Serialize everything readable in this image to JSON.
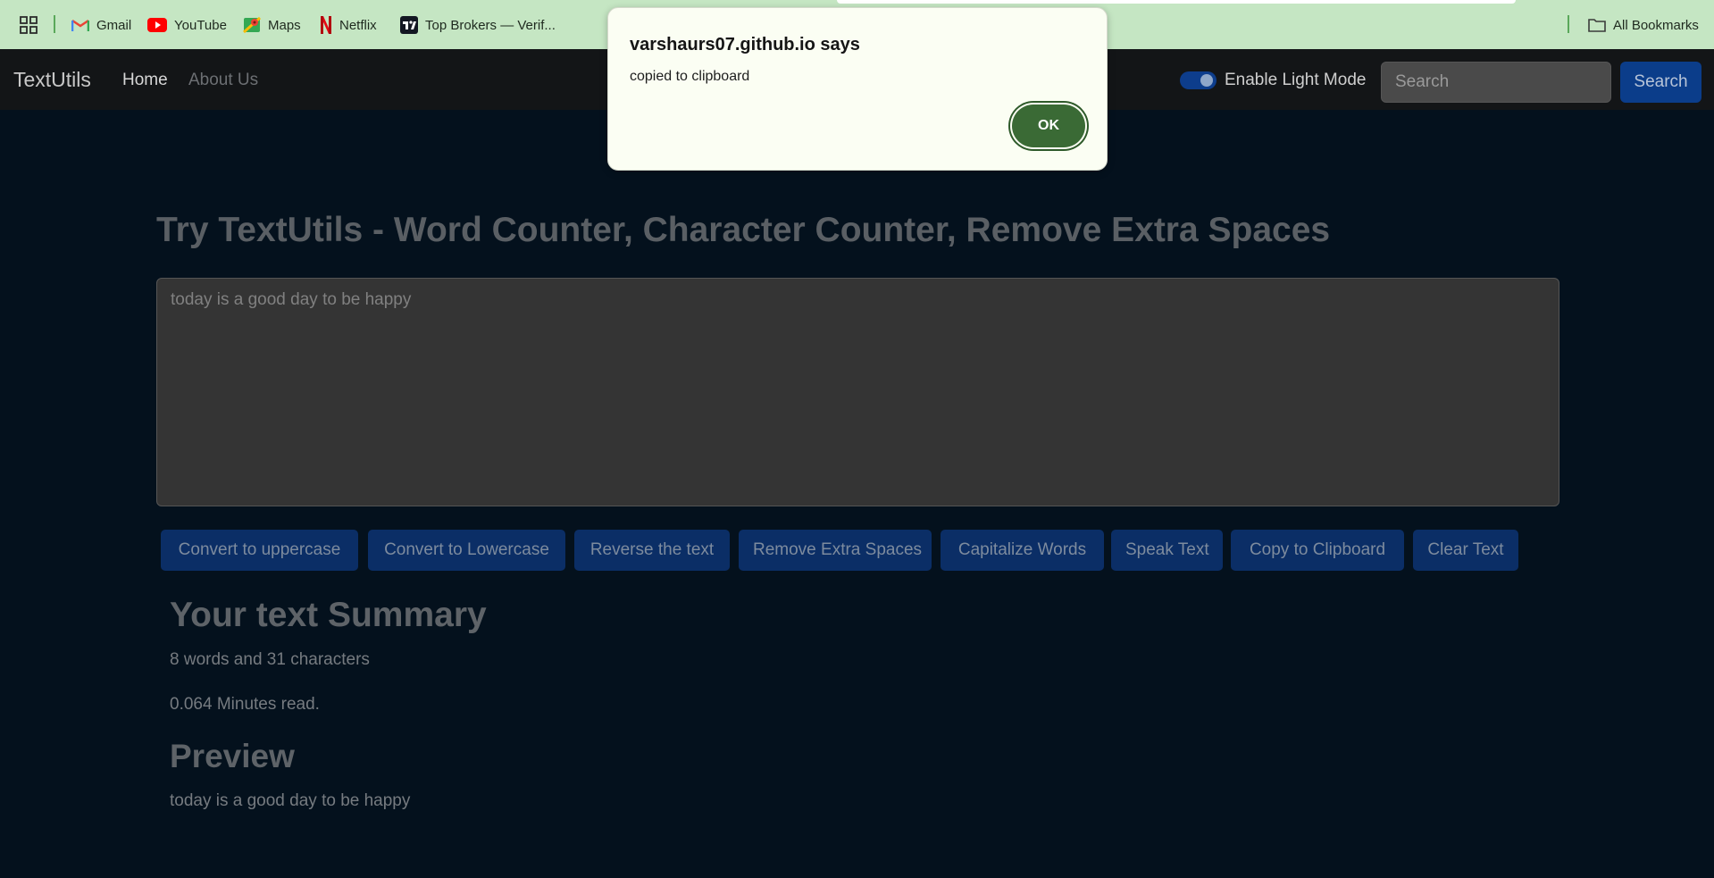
{
  "bookmarks": {
    "items": [
      {
        "label": "Gmail",
        "icon": "gmail-icon"
      },
      {
        "label": "YouTube",
        "icon": "youtube-icon"
      },
      {
        "label": "Maps",
        "icon": "maps-icon"
      },
      {
        "label": "Netflix",
        "icon": "netflix-icon"
      },
      {
        "label": "Top Brokers — Verif...",
        "icon": "tradingview-icon"
      }
    ],
    "all_bookmarks": "All Bookmarks"
  },
  "navbar": {
    "brand": "TextUtils",
    "links": [
      "Home",
      "About Us"
    ],
    "toggle_label": "Enable Light Mode",
    "toggle_on": true,
    "search_placeholder": "Search",
    "search_button": "Search"
  },
  "main": {
    "heading": "Try TextUtils - Word Counter, Character Counter, Remove Extra Spaces",
    "textarea_value": "today is a good day to be happy",
    "buttons": [
      "Convert to uppercase",
      "Convert to Lowercase",
      "Reverse the text",
      "Remove Extra Spaces",
      "Capitalize Words",
      "Speak Text",
      "Copy to Clipboard",
      "Clear Text"
    ],
    "summary_title": "Your text Summary",
    "summary_counts": "8 words and 31 characters",
    "summary_read": "0.064 Minutes read.",
    "preview_title": "Preview",
    "preview_text": "today is a good day to be happy"
  },
  "dialog": {
    "title": "varshaurs07.github.io says",
    "message": "copied to clipboard",
    "ok": "OK"
  },
  "colors": {
    "page_bg": "#04111d",
    "navbar_bg": "#131517",
    "button_bg": "#0b2e66",
    "dialog_ok": "#3a6a35",
    "bookmarks_bg": "#c5e6c3"
  }
}
